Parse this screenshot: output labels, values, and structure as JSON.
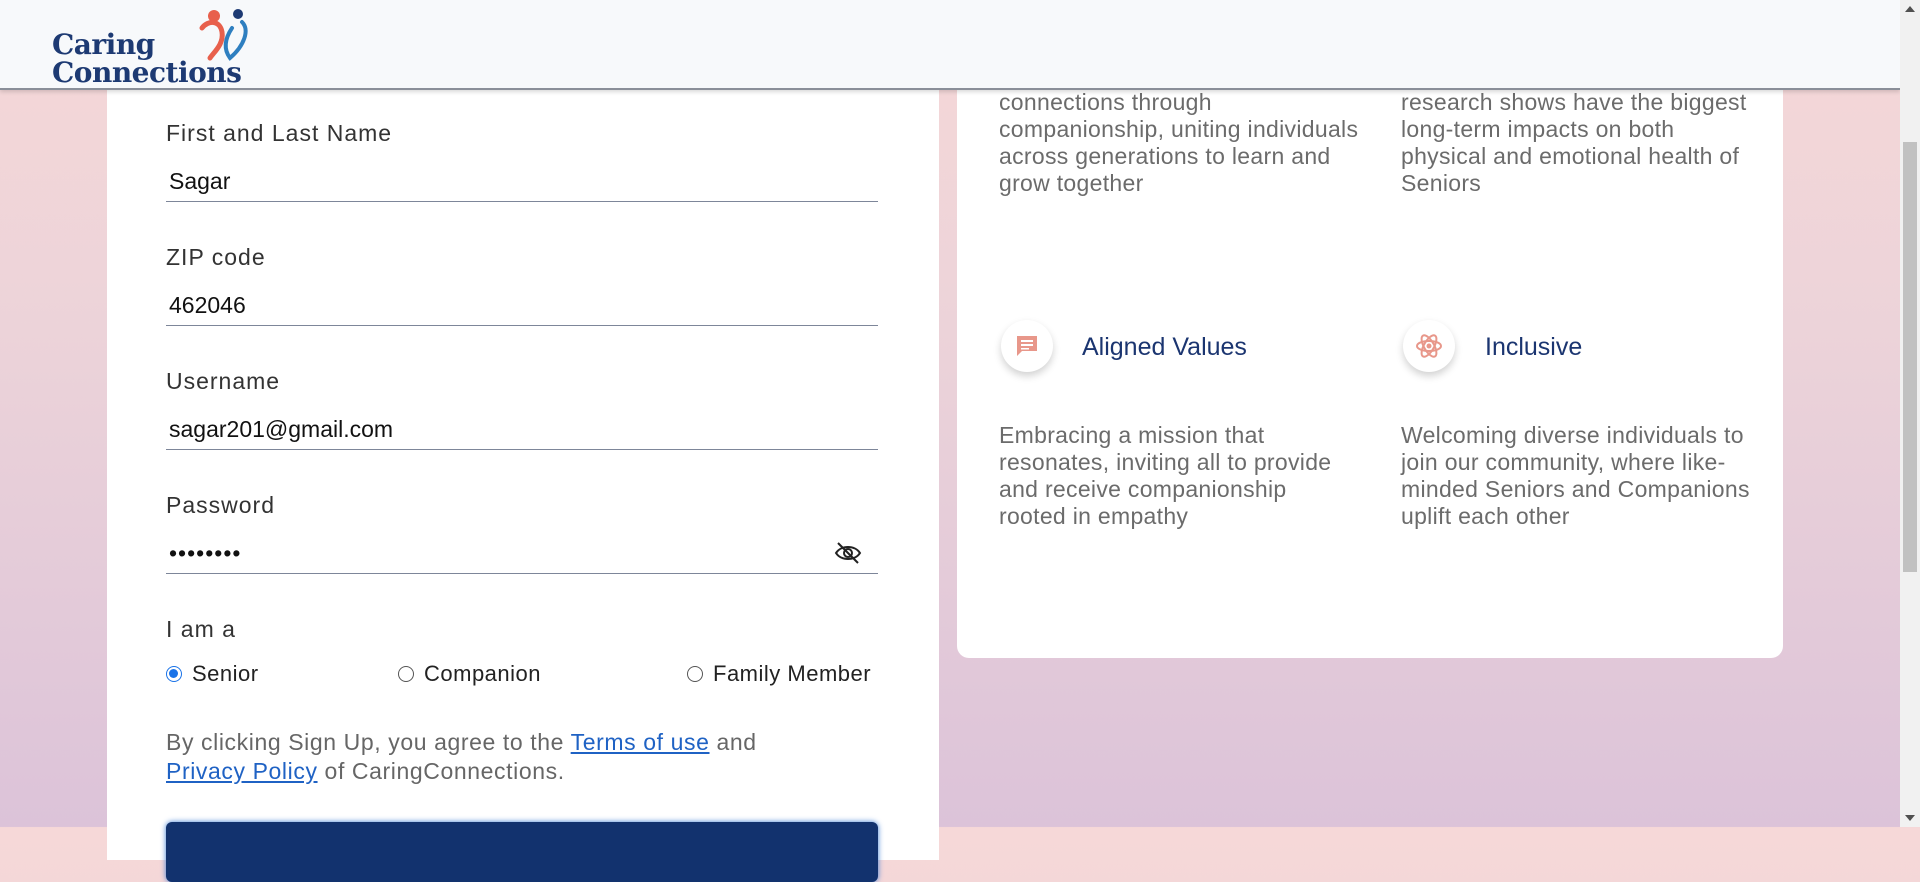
{
  "header": {
    "logo_line1": "Caring",
    "logo_line2": "Connections"
  },
  "form": {
    "name_label": "First and Last Name",
    "name_value": "Sagar",
    "zip_label": "ZIP code",
    "zip_value": "462046",
    "username_label": "Username",
    "username_value": "sagar201@gmail.com",
    "password_label": "Password",
    "password_value": "••••••••",
    "role_label": "I am a",
    "roles": [
      {
        "label": "Senior",
        "checked": true
      },
      {
        "label": "Companion",
        "checked": false
      },
      {
        "label": "Family Member",
        "checked": false
      }
    ],
    "terms_prefix": "By clicking Sign Up, you agree to the",
    "terms_link": "Terms of use",
    "terms_and": "and",
    "privacy_link": "Privacy Policy",
    "terms_suffix": "of CaringConnections."
  },
  "features": {
    "top_left_text": "connections through companionship, uniting individuals across generations to learn and grow together",
    "top_right_text": "research shows have the biggest long-term impacts on both physical and emotional health of Seniors",
    "aligned": {
      "title": "Aligned Values",
      "icon": "chat-icon",
      "text": "Embracing a mission that resonates, inviting all to provide and receive companionship rooted in empathy"
    },
    "inclusive": {
      "title": "Inclusive",
      "icon": "atom-icon",
      "text": "Welcoming diverse individuals to join our community, where like-minded Seniors and Companions uplift each other"
    }
  },
  "colors": {
    "brand_navy": "#1d3a73",
    "link_blue": "#1f62c4",
    "radio_blue": "#1a73e8",
    "icon_salmon": "#e8978a"
  }
}
